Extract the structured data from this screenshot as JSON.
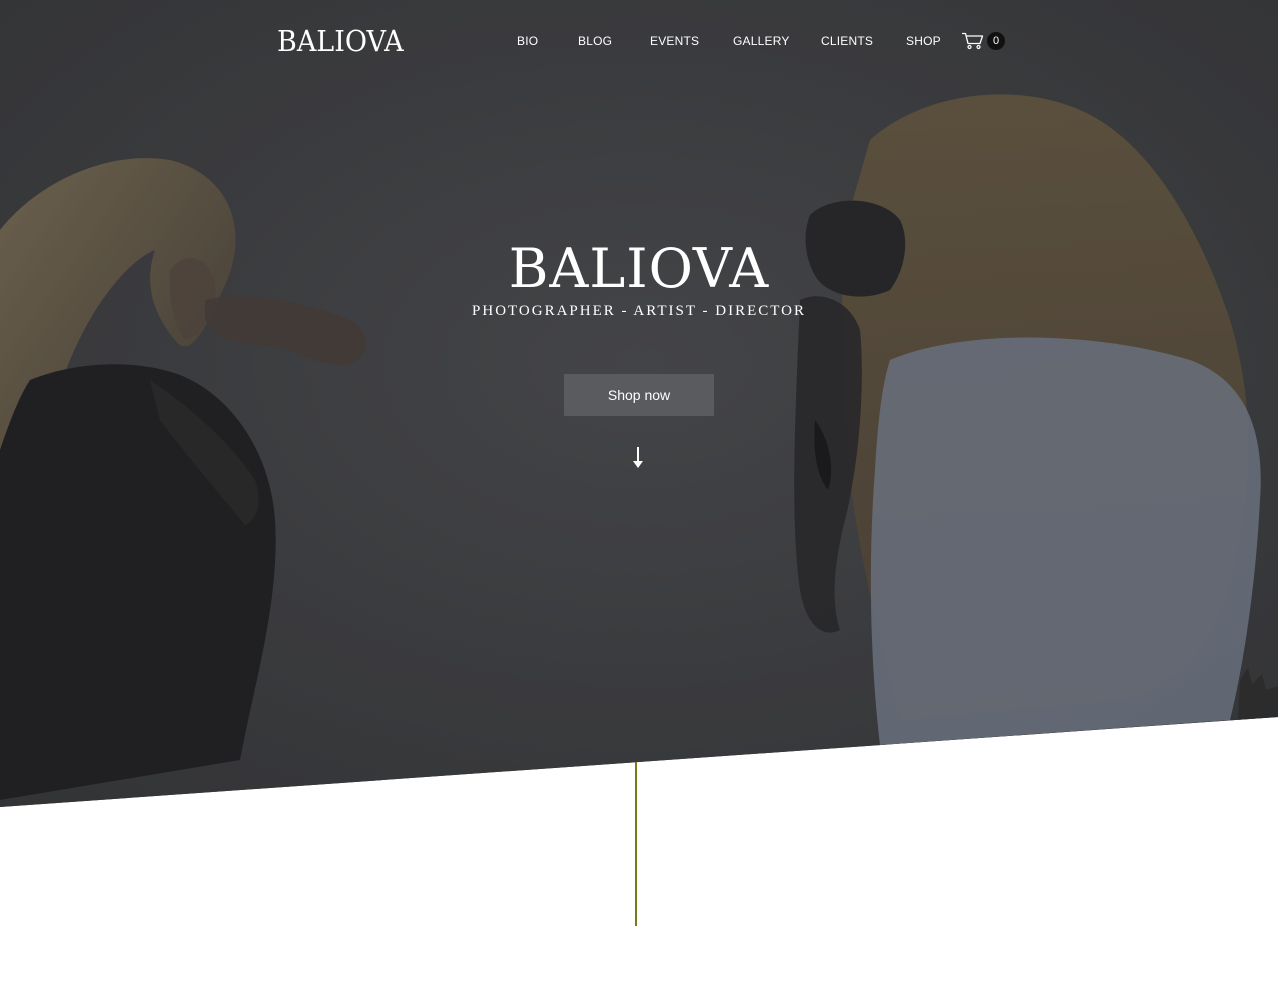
{
  "header": {
    "logo": "BALIOVA",
    "nav": {
      "bio": "BIO",
      "blog": "BLOG",
      "events": "EVENTS",
      "gallery": "GALLERY",
      "clients": "CLIENTS",
      "shop": "SHOP"
    },
    "cart": {
      "icon": "shopping-cart-icon",
      "count": "0"
    }
  },
  "hero": {
    "title": "BALIOVA",
    "subtitle": "PHOTOGRAPHER - ARTIST - DIRECTOR",
    "cta_label": "Shop now",
    "scroll_icon": "arrow-down-icon"
  },
  "colors": {
    "hero_overlay": "#444549",
    "button_bg": "#5a5b5f",
    "accent_line": "#7a7a1c",
    "text_light": "#ffffff",
    "cart_badge": "#111111"
  }
}
